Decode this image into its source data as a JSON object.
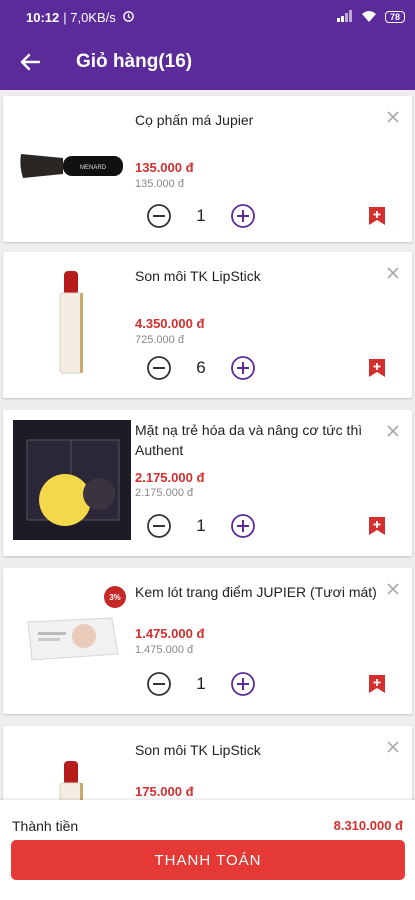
{
  "status_bar": {
    "time": "10:12",
    "speed": "| 7,0KB/s",
    "battery": "78"
  },
  "header": {
    "title": "Giỏ hàng(16)"
  },
  "items": [
    {
      "name": "Cọ phấn má Jupier",
      "price": "135.000 đ",
      "old_price": "135.000 đ",
      "qty": "1",
      "image": "blush-brush",
      "brand_text": "MENARD"
    },
    {
      "name": "Son môi TK LipStick",
      "price": "4.350.000 đ",
      "old_price": "725.000 đ",
      "qty": "6",
      "image": "lipstick"
    },
    {
      "name": "Mặt nạ trẻ hóa da và nâng cơ tức thì Authent",
      "price": "2.175.000 đ",
      "old_price": "2.175.000 đ",
      "qty": "1",
      "image": "face-mask-box"
    },
    {
      "name": "Kem lót trang điểm JUPIER (Tươi mát)",
      "price": "1.475.000 đ",
      "old_price": "1.475.000 đ",
      "qty": "1",
      "image": "primer-box",
      "badge": "3%"
    },
    {
      "name": "Son môi TK LipStick",
      "price": "175.000 đ",
      "image": "lipstick"
    }
  ],
  "footer": {
    "total_label": "Thành tiền",
    "total_value": "8.310.000 đ",
    "checkout_label": "THANH TOÁN"
  },
  "colors": {
    "primary": "#5b2b9a",
    "accent": "#e53935",
    "price": "#d32f2f"
  }
}
